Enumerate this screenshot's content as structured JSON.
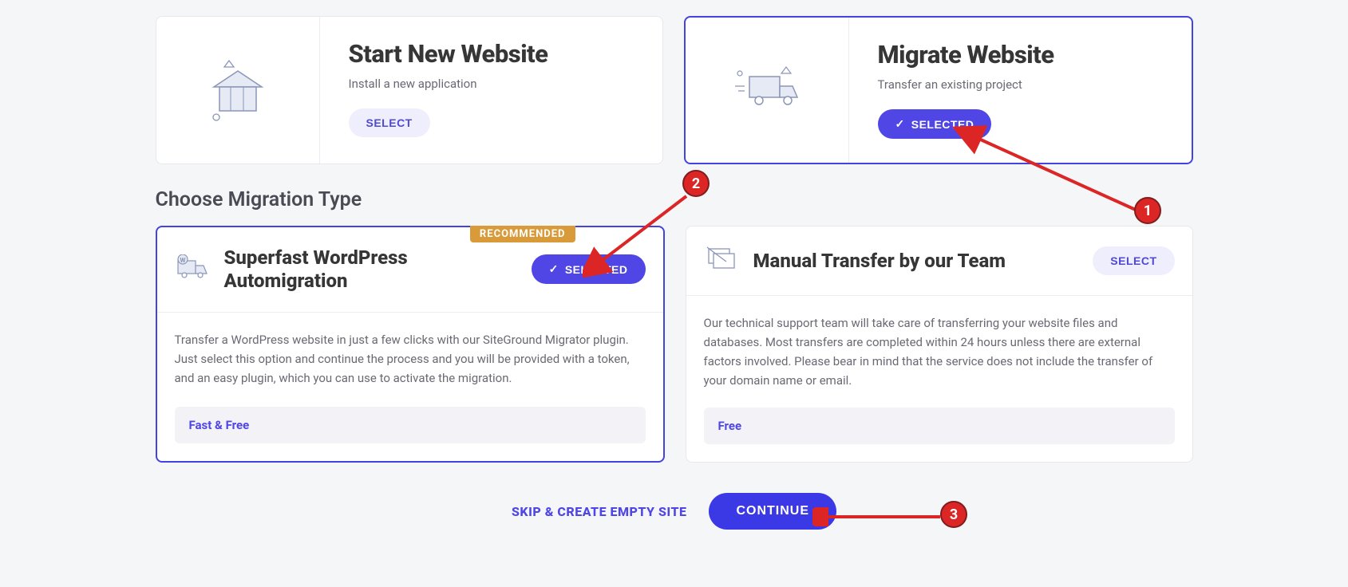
{
  "top": {
    "new": {
      "title": "Start New Website",
      "sub": "Install a new application",
      "btn": "SELECT"
    },
    "migrate": {
      "title": "Migrate Website",
      "sub": "Transfer an existing project",
      "btn": "SELECTED"
    }
  },
  "section_head": "Choose Migration Type",
  "mig": {
    "auto": {
      "badge": "RECOMMENDED",
      "title": "Superfast WordPress Automigration",
      "btn": "SELECTED",
      "body": "Transfer a WordPress website in just a few clicks with our SiteGround Migrator plugin. Just select this option and continue the process and you will be provided with a token, and an easy plugin, which you can use to activate the migration.",
      "footer": "Fast & Free"
    },
    "manual": {
      "title": "Manual Transfer by our Team",
      "btn": "SELECT",
      "body": "Our technical support team will take care of transferring your website files and databases. Most transfers are completed within 24 hours unless there are external factors involved. Please bear in mind that the service does not include the transfer of your domain name or email.",
      "footer": "Free"
    }
  },
  "actions": {
    "skip": "SKIP & CREATE EMPTY SITE",
    "continue": "CONTINUE"
  },
  "annotations": {
    "m1": "1",
    "m2": "2",
    "m3": "3"
  }
}
